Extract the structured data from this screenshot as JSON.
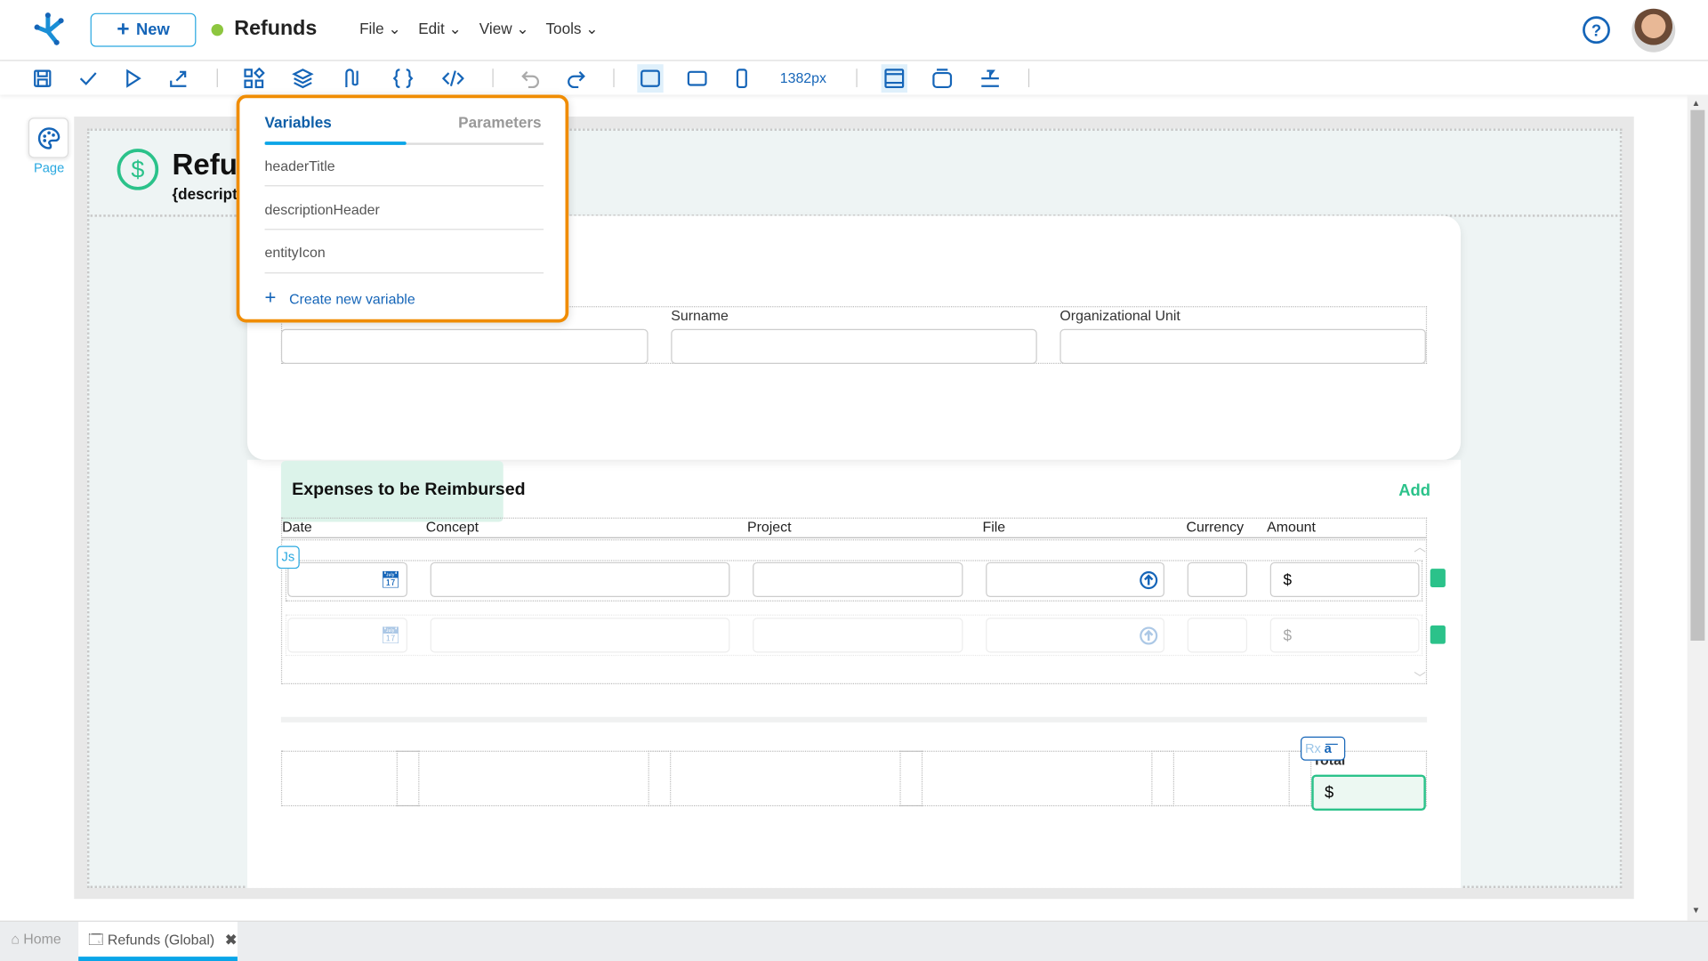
{
  "header": {
    "new_label": "New",
    "app_title": "Refunds",
    "status_color": "#8dc63f",
    "menus": [
      "File",
      "Edit",
      "View",
      "Tools"
    ]
  },
  "toolbar": {
    "width_label": "1382px",
    "icons": [
      "save-icon",
      "check-icon",
      "play-icon",
      "export-icon",
      "components-icon",
      "layers-icon",
      "flow-icon",
      "variables-icon",
      "code-icon",
      "undo-icon",
      "redo-icon",
      "desktop-icon",
      "tablet-icon",
      "mobile-icon",
      "layout-icon",
      "frame-icon",
      "align-icon"
    ]
  },
  "left_panel": {
    "page_label": "Page"
  },
  "form": {
    "header_title": "Refunds",
    "header_description": "{descriptionHeader}",
    "fields": [
      "Surname",
      "Organizational Unit"
    ],
    "expenses_title": "Expenses to be Reimbursed",
    "add_label": "Add",
    "columns": [
      "Date",
      "Concept",
      "Project",
      "File",
      "Currency",
      "Amount"
    ],
    "currency_symbol": "$",
    "js_badge": "Js",
    "rx_badge": "Rx",
    "total_label": "Total",
    "total_value": "$"
  },
  "popup": {
    "tabs": [
      "Variables",
      "Parameters"
    ],
    "active_tab": "Variables",
    "variables": [
      "headerTitle",
      "descriptionHeader",
      "entityIcon"
    ],
    "create_label": "Create new variable"
  },
  "bottom_tabs": {
    "home": "Home",
    "active": "Refunds (Global)"
  },
  "colors": {
    "primary": "#1565b8",
    "accent": "#0aa5e8",
    "success": "#2bc28a",
    "highlight": "#f08c00"
  }
}
